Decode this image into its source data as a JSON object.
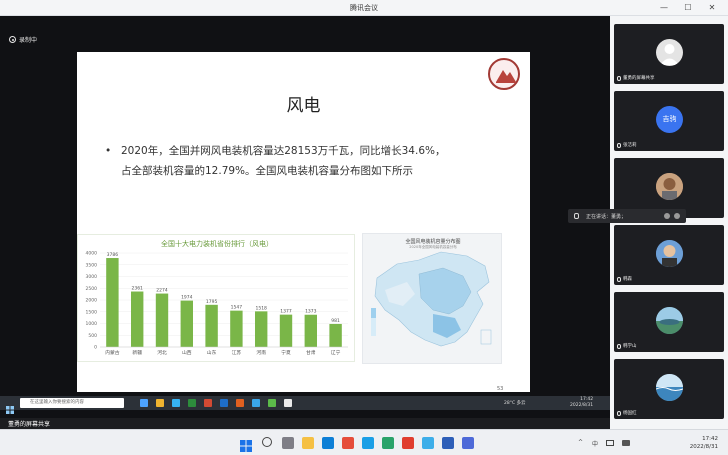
{
  "window": {
    "title": "腾讯会议",
    "minimize": "—",
    "maximize": "☐",
    "close": "✕"
  },
  "recording": {
    "label": "录制中"
  },
  "slide": {
    "title": "风电",
    "bullet_lines": [
      "2020年，全国并网风电装机容量达28153万千瓦，同比增长34.6%，",
      "占全部装机容量的12.79%。全国风电装机容量分布图如下所示"
    ],
    "page_number": "53",
    "map_title": "全国风电装机容量分布图",
    "map_subtitle": "2020年全国风电装机容量分布"
  },
  "chart_data": {
    "type": "bar",
    "title": "全国十大电力装机省份排行（风电）",
    "categories": [
      "内蒙古",
      "新疆",
      "河北",
      "山西",
      "山东",
      "江苏",
      "河南",
      "宁夏",
      "甘肃",
      "辽宁"
    ],
    "values": [
      3786,
      2361,
      2274,
      1974,
      1795,
      1547,
      1518,
      1377,
      1373,
      981
    ],
    "ylim": [
      0,
      4000
    ],
    "yticks": [
      0,
      500,
      1000,
      1500,
      2000,
      2500,
      3000,
      3500,
      4000
    ],
    "bar_color": "#7ab648",
    "grid": true
  },
  "inner_taskbar": {
    "search_placeholder": "在这里输入你要搜索的内容",
    "weather": "28°C 多云",
    "time": "17:42",
    "date": "2022/8/31"
  },
  "share_bar": {
    "label": "董勇的屏幕共享"
  },
  "participants": [
    {
      "name": "董勇的屏幕共享",
      "avatar_type": "default"
    },
    {
      "name": "张洁莉",
      "avatar_type": "text",
      "avatar_text": "吉驹",
      "avatar_color": "#3a74f0"
    },
    {
      "name": "",
      "avatar_type": "photo"
    },
    {
      "name": "韩森",
      "avatar_type": "photo"
    },
    {
      "name": "韩学山",
      "avatar_type": "photo"
    },
    {
      "name": "杨国红",
      "avatar_type": "photo"
    }
  ],
  "speaking": {
    "label": "正在讲话：董勇；"
  },
  "taskbar": {
    "time": "17:42",
    "date": "2022/8/31",
    "lang": "中",
    "tray_up": "^"
  }
}
